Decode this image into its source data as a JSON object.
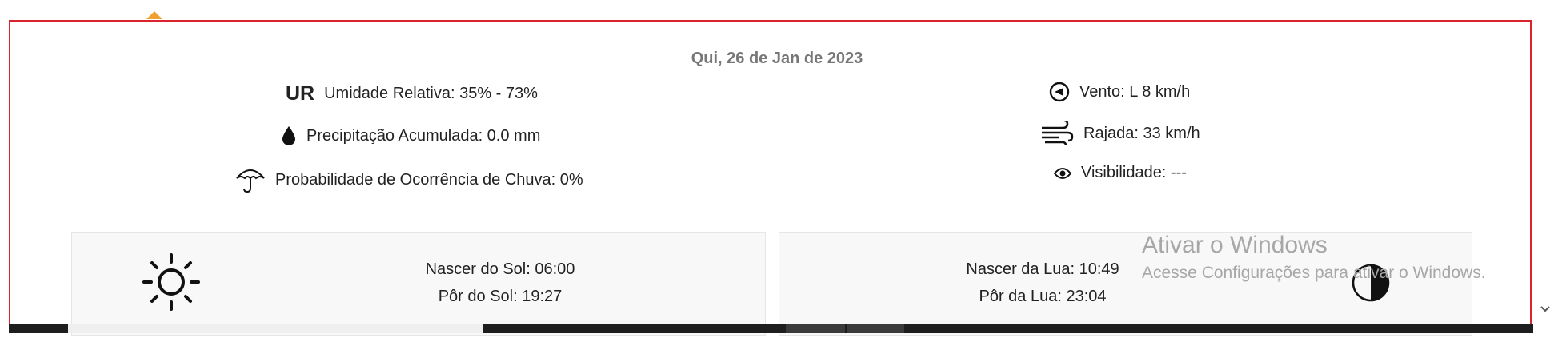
{
  "date": "Qui, 26 de Jan de 2023",
  "left_items": {
    "humidity": {
      "tag": "UR",
      "label": "Umidade Relativa: 35% - 73%",
      "icon": "ur-text-icon"
    },
    "precipitation": {
      "label": "Precipitação Acumulada: 0.0 mm",
      "icon": "drop-icon"
    },
    "rain_probability": {
      "label": "Probabilidade de Ocorrência de Chuva: 0%",
      "icon": "umbrella-icon"
    }
  },
  "right_items": {
    "wind": {
      "label": "Vento: L 8 km/h",
      "icon": "wind-direction-icon"
    },
    "gust": {
      "label": "Rajada: 33 km/h",
      "icon": "wind-gust-icon"
    },
    "visibility": {
      "label": "Visibilidade: ---",
      "icon": "eye-icon"
    }
  },
  "sun": {
    "rise": "Nascer do Sol: 06:00",
    "set": "Pôr do Sol: 19:27",
    "icon": "sun-icon"
  },
  "moon": {
    "rise": "Nascer da Lua: 10:49",
    "set": "Pôr da Lua: 23:04",
    "icon": "half-moon-icon"
  },
  "watermark": {
    "title": "Ativar o Windows",
    "subtitle": "Acesse Configurações para ativar o Windows."
  },
  "colors": {
    "border": "#d9232e",
    "caret": "#f0a030",
    "date_text": "#777777"
  }
}
